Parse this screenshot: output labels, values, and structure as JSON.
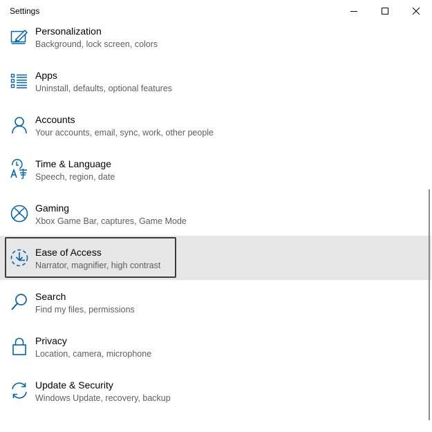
{
  "window": {
    "title": "Settings"
  },
  "controls": {
    "minimize": "minimize-icon",
    "maximize": "maximize-icon",
    "close": "close-icon"
  },
  "accent_color": "#0063b1",
  "selected_bg": "#e6e6e6",
  "items": [
    {
      "icon": "personalization-icon",
      "label": "Personalization",
      "desc": "Background, lock screen, colors"
    },
    {
      "icon": "apps-icon",
      "label": "Apps",
      "desc": "Uninstall, defaults, optional features"
    },
    {
      "icon": "accounts-icon",
      "label": "Accounts",
      "desc": "Your accounts, email, sync, work, other people"
    },
    {
      "icon": "time-language-icon",
      "label": "Time & Language",
      "desc": "Speech, region, date"
    },
    {
      "icon": "gaming-icon",
      "label": "Gaming",
      "desc": "Xbox Game Bar, captures, Game Mode"
    },
    {
      "icon": "ease-of-access-icon",
      "label": "Ease of Access",
      "desc": "Narrator, magnifier, high contrast",
      "selected": true
    },
    {
      "icon": "search-icon",
      "label": "Search",
      "desc": "Find my files, permissions"
    },
    {
      "icon": "privacy-icon",
      "label": "Privacy",
      "desc": "Location, camera, microphone"
    },
    {
      "icon": "update-security-icon",
      "label": "Update & Security",
      "desc": "Windows Update, recovery, backup"
    }
  ]
}
